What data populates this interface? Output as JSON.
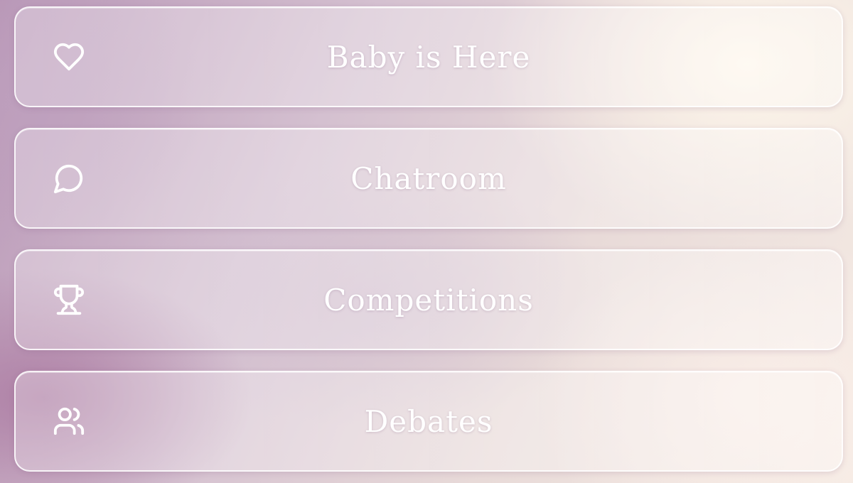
{
  "menu": {
    "items": [
      {
        "label": "Baby is Here",
        "icon": "heart-icon"
      },
      {
        "label": "Chatroom",
        "icon": "chat-bubble-icon"
      },
      {
        "label": "Competitions",
        "icon": "trophy-icon"
      },
      {
        "label": "Debates",
        "icon": "users-icon"
      }
    ]
  },
  "colors": {
    "text": "#ffffff",
    "border": "#ffffff",
    "background_left": "#b896b6",
    "background_right": "#f5ebe4"
  }
}
